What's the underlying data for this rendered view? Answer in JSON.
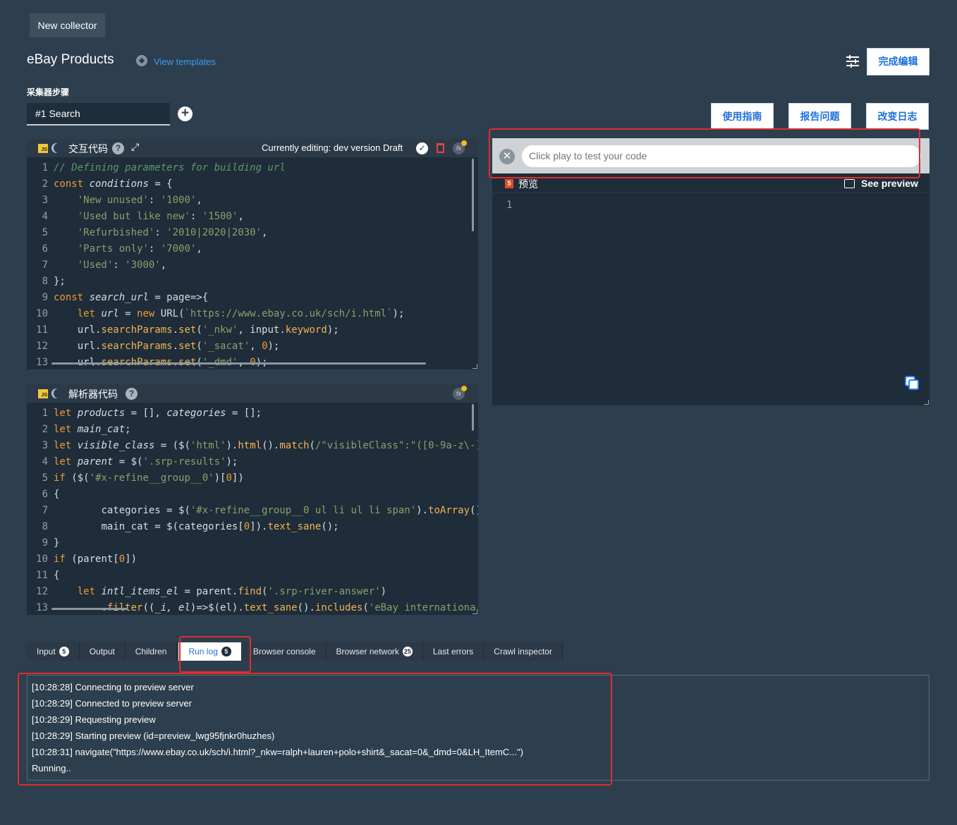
{
  "top_tab": "New collector",
  "header": {
    "title": "eBay Products",
    "view_templates": "View templates",
    "done_button": "完成编辑"
  },
  "steps": {
    "label": "采集器步骤",
    "tab": "#1 Search"
  },
  "buttons": {
    "guide": "使用指南",
    "report": "报告问题",
    "changelog": "改变日志"
  },
  "interaction_editor": {
    "title": "交互代码",
    "status": "Currently editing: dev version Draft",
    "line_numbers": [
      "1",
      "2",
      "3",
      "4",
      "5",
      "6",
      "7",
      "8",
      "9",
      "10",
      "11",
      "12",
      "13"
    ]
  },
  "parser_editor": {
    "title": "解析器代码",
    "line_numbers": [
      "1",
      "2",
      "3",
      "4",
      "5",
      "6",
      "7",
      "8",
      "9",
      "10",
      "11",
      "12",
      "13"
    ]
  },
  "preview": {
    "url_placeholder": "Click play to test your code",
    "label": "预览",
    "see_preview": "See preview",
    "line_number": "1"
  },
  "tabs": [
    {
      "label": "Input",
      "badge": "5"
    },
    {
      "label": "Output"
    },
    {
      "label": "Children"
    },
    {
      "label": "Run log",
      "badge": "5",
      "active": true
    },
    {
      "label": "Browser console"
    },
    {
      "label": "Browser network",
      "badge": "25"
    },
    {
      "label": "Last errors"
    },
    {
      "label": "Crawl inspector"
    }
  ],
  "run_log": [
    "[10:28:28] Connecting to preview server",
    "[10:28:29] Connected to preview server",
    "[10:28:29] Requesting preview",
    "[10:28:29] Starting preview (id=preview_lwg95fjnkr0huzhes)",
    "[10:28:31] navigate(\"https://www.ebay.co.uk/sch/i.html?_nkw=ralph+lauren+polo+shirt&_sacat=0&_dmd=0&LH_ItemC...\")",
    "Running.."
  ],
  "colors": {
    "background": "#2d3e4e",
    "editor_bg": "#1f2c39",
    "accent": "#1e6fd9",
    "highlight": "#e02d2d"
  }
}
